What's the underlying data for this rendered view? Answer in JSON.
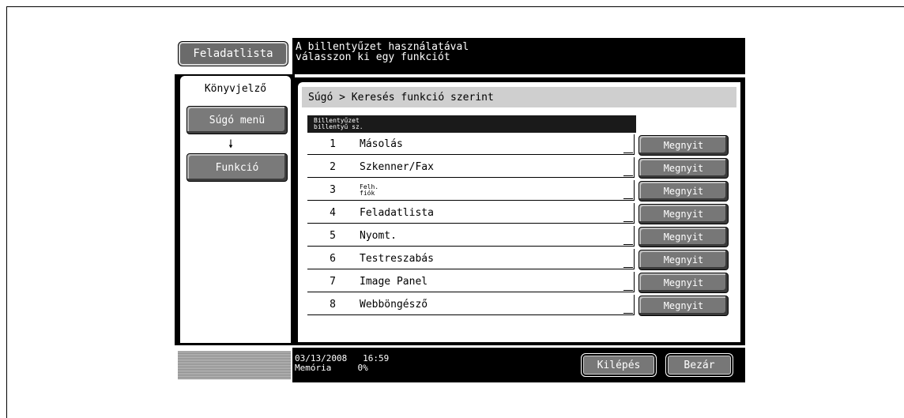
{
  "header": {
    "job_list_button": "Feladatlista",
    "message_line1": "A billentyűzet használatával",
    "message_line2": "válasszon ki egy funkciót"
  },
  "sidebar": {
    "tab_label": "Könyvjelző",
    "help_menu_button": "Súgó menü",
    "arrow_glyph": "🠗",
    "function_button": "Funkció"
  },
  "main": {
    "breadcrumb": "Súgó > Keresés funkció szerint",
    "list_header_line1": "Billentyűzet",
    "list_header_line2": "billentyű sz.",
    "open_label": "Megnyit",
    "rows": [
      {
        "num": "1",
        "label": "Másolás"
      },
      {
        "num": "2",
        "label": "Szkenner/Fax"
      },
      {
        "num": "3",
        "label_line1": "Felh.",
        "label_line2": "fiók"
      },
      {
        "num": "4",
        "label": "Feladatlista"
      },
      {
        "num": "5",
        "label": "Nyomt."
      },
      {
        "num": "6",
        "label": "Testreszabás"
      },
      {
        "num": "7",
        "label": "Image Panel"
      },
      {
        "num": "8",
        "label": "Webböngésző"
      }
    ]
  },
  "footer": {
    "date": "03/13/2008",
    "time": "16:59",
    "memory_label": "Memória",
    "memory_value": "0%",
    "exit_button": "Kilépés",
    "close_button": "Bezár"
  }
}
